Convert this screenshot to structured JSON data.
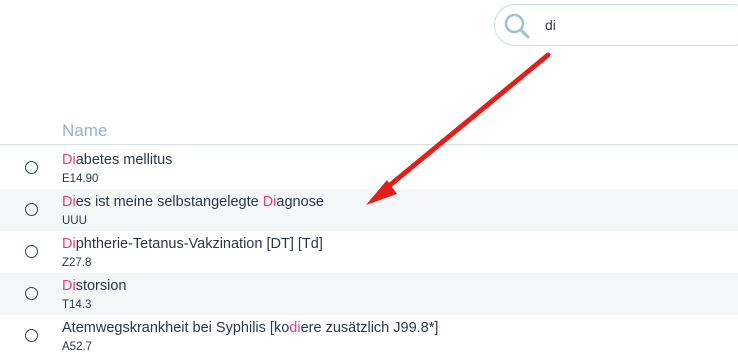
{
  "search": {
    "value": "di",
    "icon": "search-icon"
  },
  "list": {
    "header": "Name",
    "rows": [
      {
        "name_hl": "Di",
        "name_rest": "abetes mellitus",
        "code": "E14.90"
      },
      {
        "name_hl": "Di",
        "name_mid": "es ist meine selbstangelegte ",
        "name_hl2": "Di",
        "name_rest": "agnose",
        "code": "UUU"
      },
      {
        "name_hl": "Di",
        "name_rest": "phtherie-Tetanus-Vakzination [DT] [Td]",
        "code": "Z27.8"
      },
      {
        "name_hl": "Di",
        "name_rest": "storsion",
        "code": "T14.3"
      },
      {
        "name_pre": "Atemwegskrankheit bei Syphilis [ko",
        "name_hl": "di",
        "name_rest": "ere zusätzlich J99.8*]",
        "code": "A52.7"
      }
    ]
  },
  "colors": {
    "highlight": "#e0407a",
    "arrow": "#e0201a",
    "header": "#8fb4cc"
  }
}
